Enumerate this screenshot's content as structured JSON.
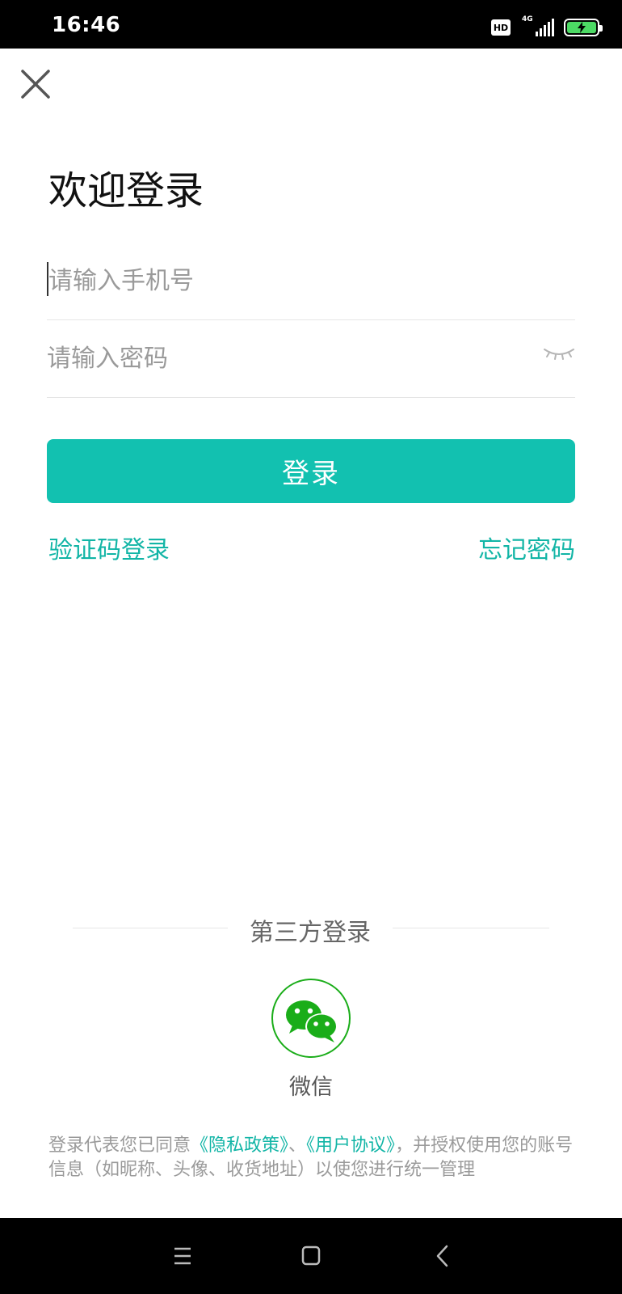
{
  "status_bar": {
    "time": "16:46",
    "hd": "HD",
    "network": "4G",
    "icons": [
      "hd-icon",
      "signal-icon",
      "battery-charging-icon"
    ]
  },
  "header": {
    "close_icon": "close-icon",
    "title": "欢迎登录"
  },
  "form": {
    "phone_placeholder": "请输入手机号",
    "phone_value": "",
    "password_placeholder": "请输入密码",
    "password_value": "",
    "password_toggle_icon": "eye-closed-icon",
    "login_label": "登录",
    "sms_login_link": "验证码登录",
    "forgot_password_link": "忘记密码"
  },
  "third_party": {
    "label": "第三方登录",
    "wechat_label": "微信",
    "wechat_icon": "wechat-icon"
  },
  "agreement": {
    "prefix": "登录代表您已同意",
    "privacy": "《隐私政策》",
    "separator": "、",
    "terms": "《用户协议》",
    "suffix": "，并授权使用您的账号信息（如昵称、头像、收货地址）以使您进行统一管理"
  },
  "nav_bar": {
    "icons": [
      "menu-icon",
      "home-icon",
      "back-icon"
    ]
  },
  "colors": {
    "accent": "#12c1b0",
    "link": "#12b5a6",
    "wechat": "#1aad19",
    "placeholder": "#9a9a9a",
    "battery": "#4cd964"
  }
}
